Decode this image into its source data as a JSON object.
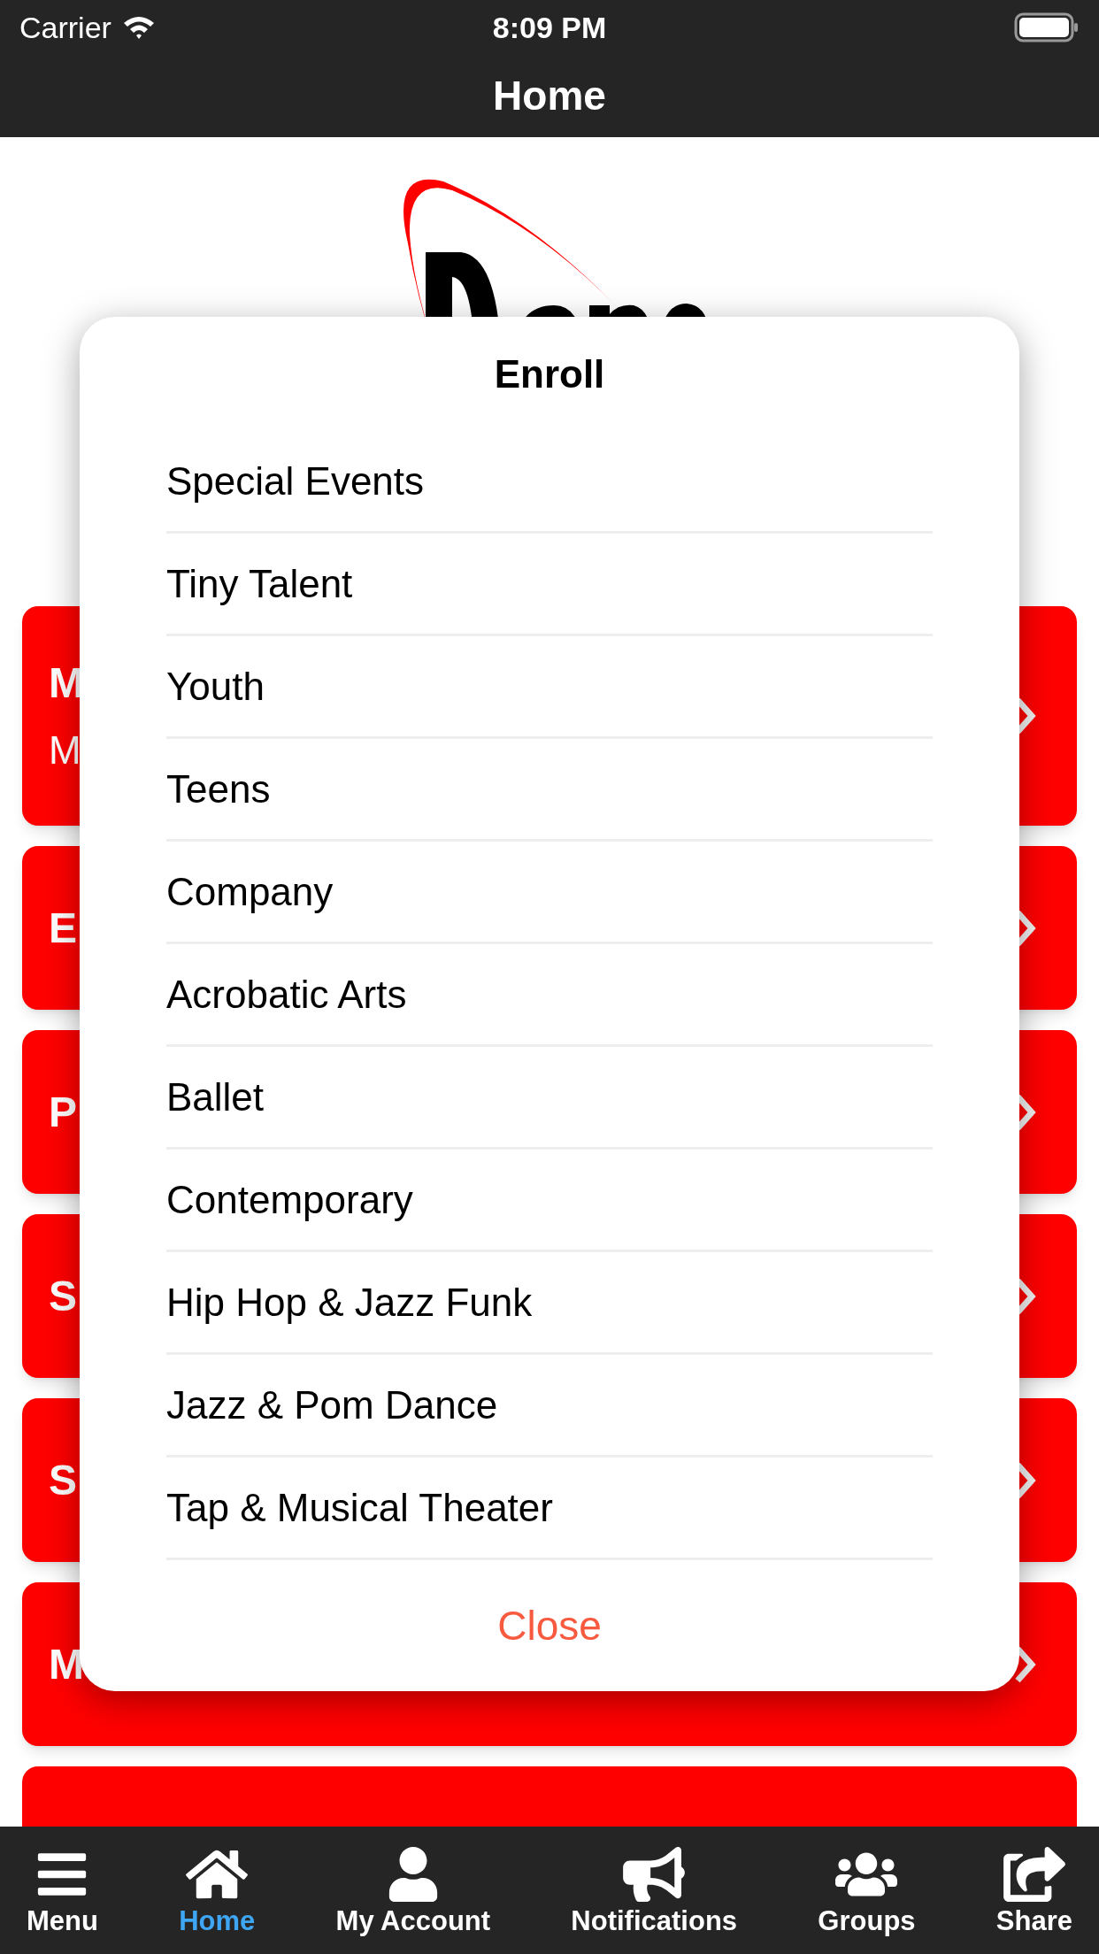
{
  "status_bar": {
    "carrier": "Carrier",
    "time": "8:09 PM"
  },
  "nav_bar": {
    "title": "Home"
  },
  "cards": [
    {
      "title": "M",
      "subtitle": "M"
    },
    {
      "title": "E"
    },
    {
      "title": "P"
    },
    {
      "title": "S"
    },
    {
      "title": "S"
    },
    {
      "title": "M"
    }
  ],
  "modal": {
    "title": "Enroll",
    "items": [
      "Special Events",
      "Tiny Talent",
      "Youth",
      "Teens",
      "Company",
      "Acrobatic Arts",
      "Ballet",
      "Contemporary",
      "Hip Hop & Jazz Funk",
      "Jazz & Pom Dance",
      "Tap & Musical Theater"
    ],
    "close": "Close"
  },
  "tab_bar": [
    {
      "kind": "menu",
      "label": "Menu",
      "selected": false
    },
    {
      "kind": "home",
      "label": "Home",
      "selected": true
    },
    {
      "kind": "account",
      "label": "My Account",
      "selected": false
    },
    {
      "kind": "notifications",
      "label": "Notifications",
      "selected": false
    },
    {
      "kind": "groups",
      "label": "Groups",
      "selected": false
    },
    {
      "kind": "share",
      "label": "Share",
      "selected": false
    }
  ]
}
